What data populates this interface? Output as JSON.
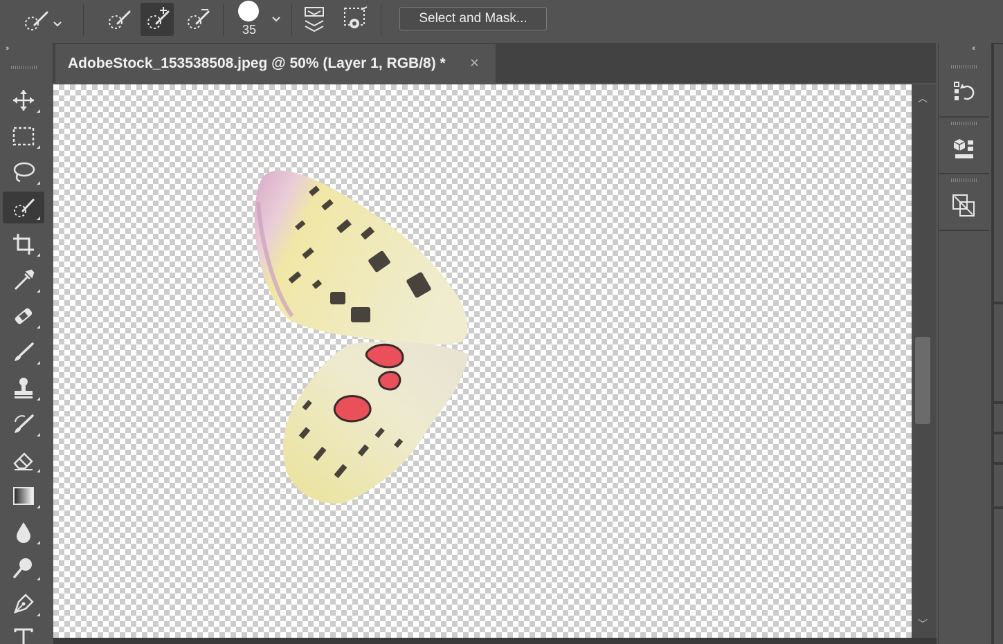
{
  "options_bar": {
    "tool_preset_icon": "quick-selection-icon",
    "mode_icons": [
      "new-selection-icon",
      "add-to-selection-icon",
      "subtract-from-selection-icon"
    ],
    "brush_size": "35",
    "sample_all_layers_icon": "layers-stack-icon",
    "auto_enhance_icon": "auto-enhance-icon",
    "select_and_mask_label": "Select and Mask..."
  },
  "document": {
    "tab_title": "AdobeStock_153538508.jpeg @ 50% (Layer 1, RGB/8) *",
    "close_symbol": "×"
  },
  "toolbar": {
    "collapse_symbol": "››",
    "active_tool": "quick-selection",
    "tools": [
      "move",
      "marquee",
      "lasso",
      "quick-selection",
      "crop",
      "eyedropper",
      "healing-brush",
      "brush",
      "clone-stamp",
      "history-brush",
      "eraser",
      "gradient",
      "blur",
      "dodge",
      "pen",
      "type"
    ]
  },
  "right_panel": {
    "collapse_symbol": "‹‹",
    "buttons": [
      "history-icon",
      "3d-materials-icon",
      "swatches-toggle-icon"
    ]
  },
  "colors": {
    "ui_bg": "#535353",
    "tab_bar": "#424242",
    "active_tool_bg": "#3a3a3a",
    "wing_pink": "#d8a9c6",
    "wing_cream": "#efeccf",
    "spot_red": "#e9505a"
  }
}
